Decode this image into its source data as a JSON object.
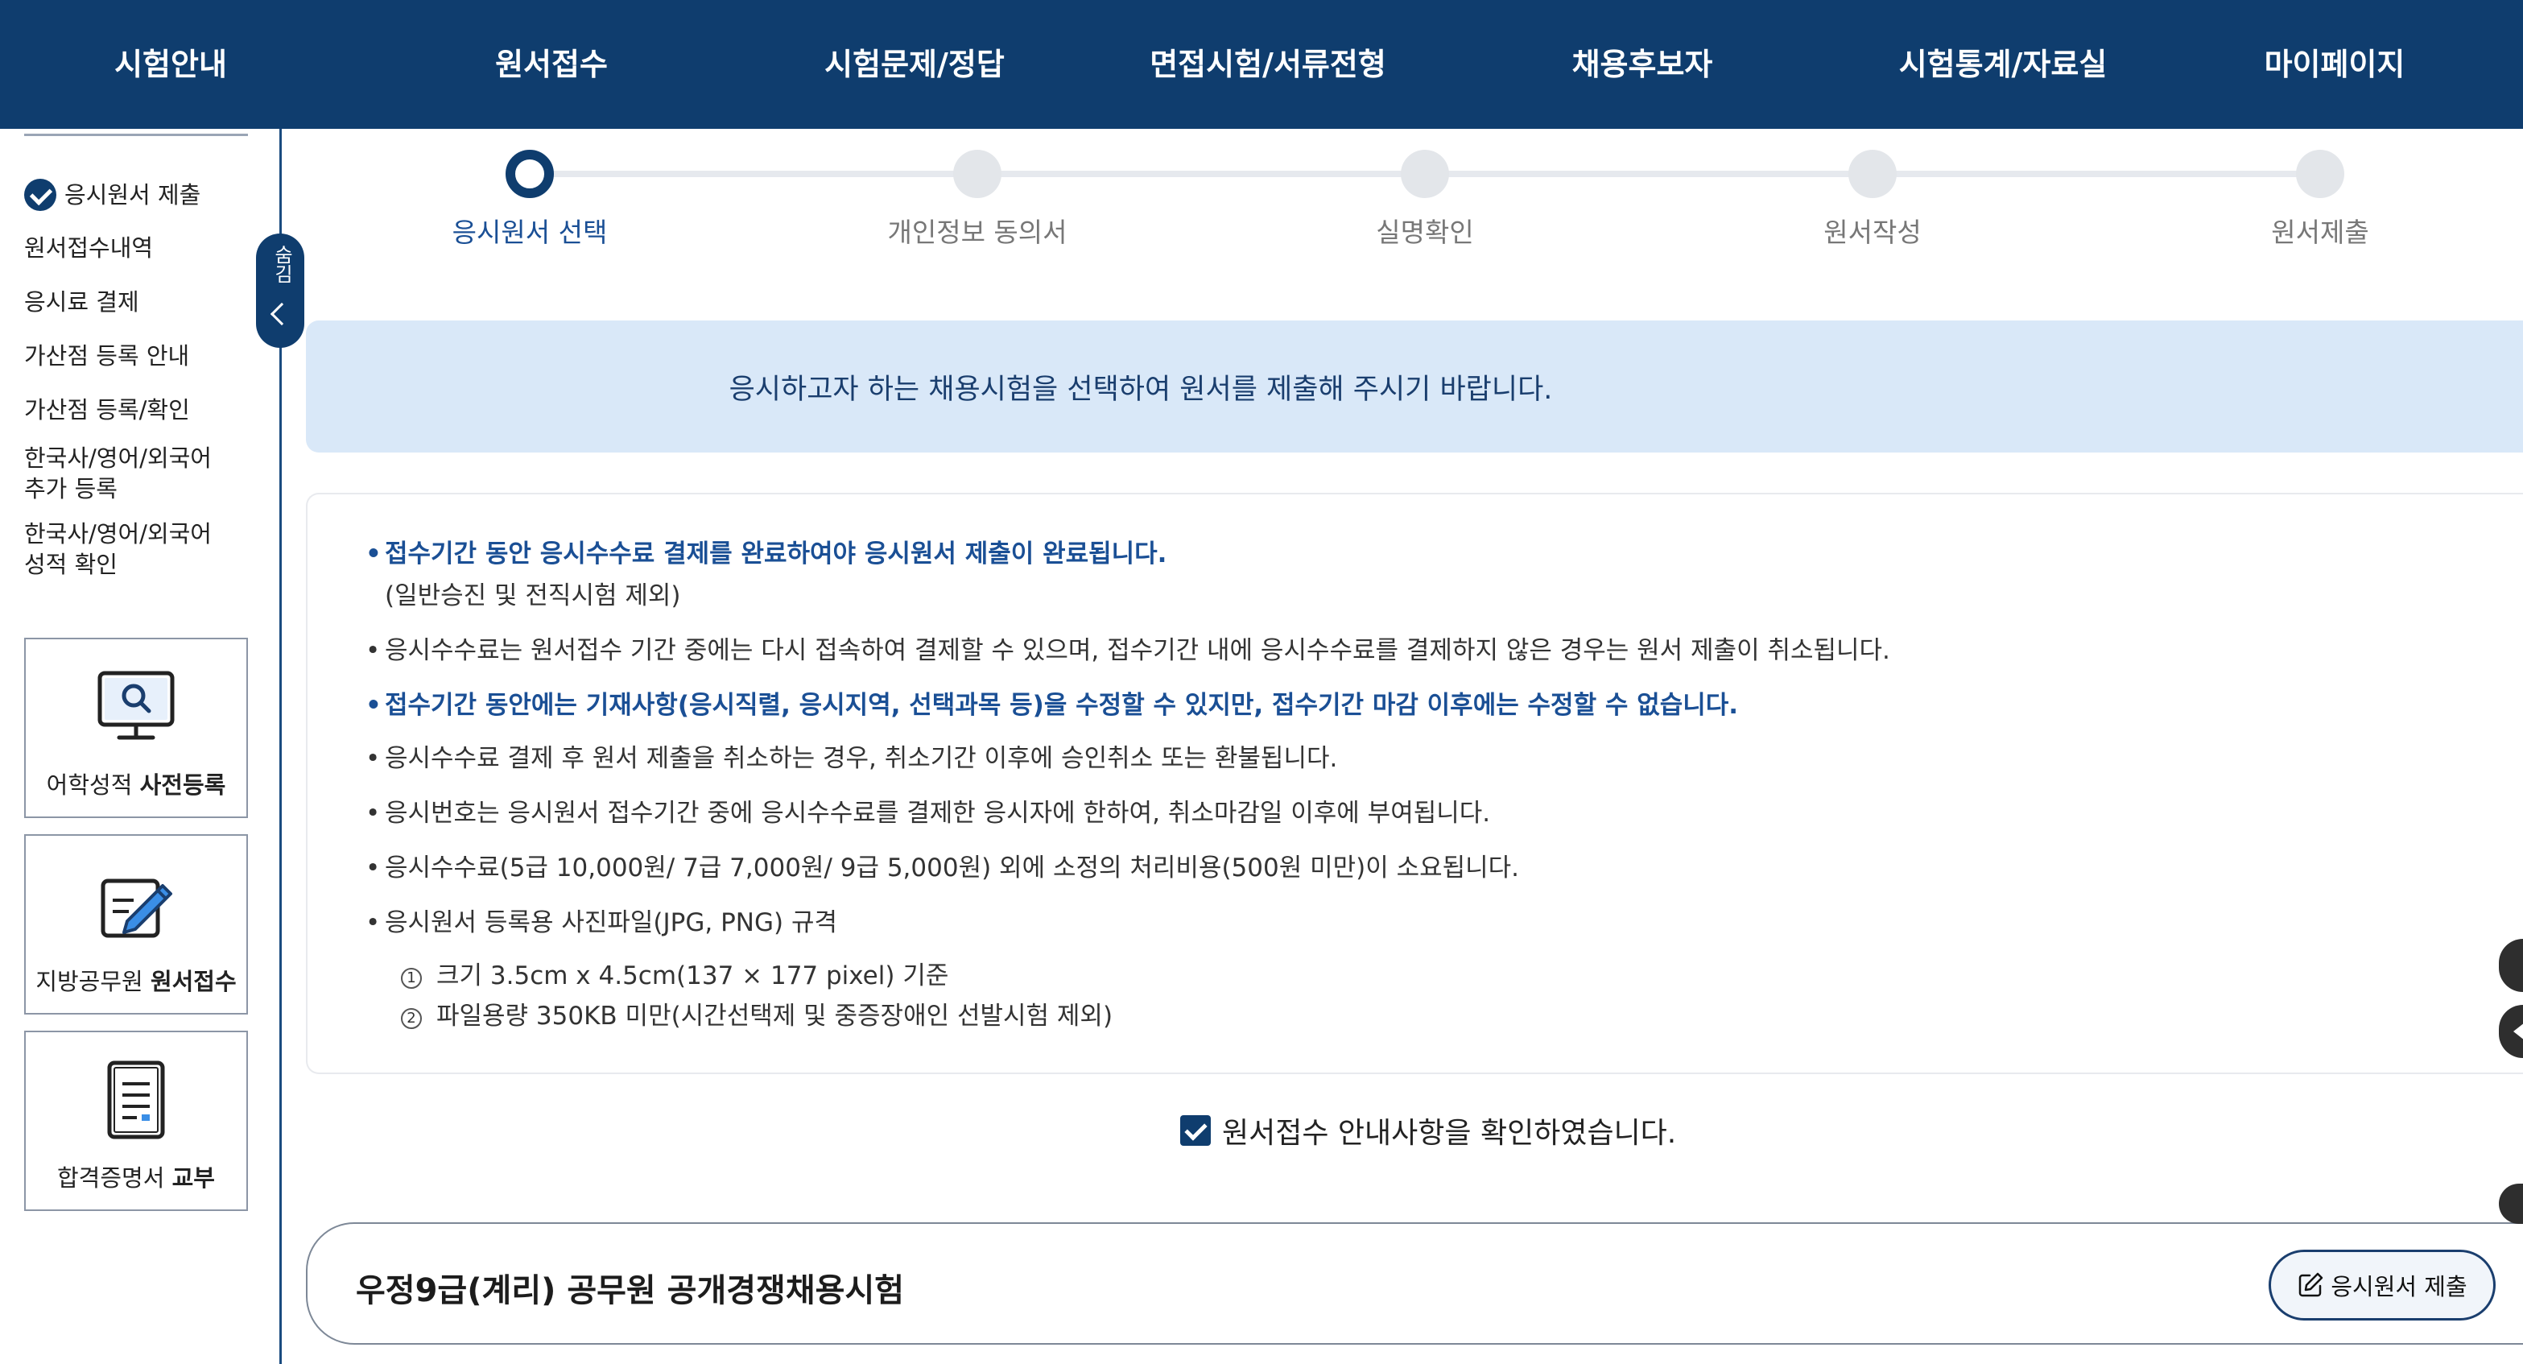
{
  "nav": {
    "items": [
      "시험안내",
      "원서접수",
      "시험문제/정답",
      "면접시험/서류전형",
      "채용후보자",
      "시험통계/자료실",
      "마이페이지"
    ]
  },
  "sidebar": {
    "menu": [
      "응시원서 제출",
      "원서접수내역",
      "응시료 결제",
      "가산점 등록 안내",
      "가산점 등록/확인",
      "한국사/영어/외국어",
      "추가 등록",
      "한국사/영어/외국어",
      "성적 확인"
    ],
    "cards": [
      {
        "label_plain": "어학성적 ",
        "label_bold": "사전등록",
        "icon": "monitor-search-icon"
      },
      {
        "label_plain": "지방공무원 ",
        "label_bold": "원서접수",
        "icon": "edit-form-icon"
      },
      {
        "label_plain": "합격증명서 ",
        "label_bold": "교부",
        "icon": "certificate-document-icon"
      }
    ],
    "collapse_label": "숨김"
  },
  "stepper": {
    "steps": [
      "응시원서 선택",
      "개인정보 동의서",
      "실명확인",
      "원서작성",
      "원서제출"
    ],
    "active_index": 0
  },
  "banner": {
    "text": "응시하고자 하는 채용시험을 선택하여 원서를 제출해 주시기 바랍니다."
  },
  "notice": {
    "bullet": "•",
    "items": [
      "접수기간 동안 응시수수료 결제를 완료하여야 응시원서 제출이 완료됩니다.",
      "(일반승진 및 전직시험 제외)",
      "응시수수료는 원서접수 기간 중에는 다시 접속하여 결제할 수 있으며, 접수기간 내에 응시수수료를 결제하지 않은 경우는 원서 제출이 취소됩니다.",
      "접수기간 동안에는 기재사항(응시직렬, 응시지역, 선택과목 등)을 수정할 수 있지만, 접수기간 마감 이후에는 수정할 수 없습니다.",
      "응시수수료 결제 후 원서 제출을 취소하는 경우, 취소기간 이후에 승인취소 또는 환불됩니다.",
      "응시번호는 응시원서 접수기간 중에 응시수수료를 결제한 응시자에 한하여, 취소마감일 이후에 부여됩니다.",
      "응시수수료(5급 10,000원/ 7급 7,000원/ 9급 5,000원) 외에 소정의 처리비용(500원 미만)이 소요됩니다.",
      "응시원서 등록용 사진파일(JPG, PNG) 규격"
    ],
    "sub_items": [
      {
        "num": "1",
        "text": "크기 3.5cm x 4.5cm(137 × 177 pixel) 기준"
      },
      {
        "num": "2",
        "text": "파일용량 350KB 미만(시간선택제 및 중증장애인 선발시험 제외)"
      }
    ]
  },
  "agreement": {
    "label": "원서접수 안내사항을 확인하였습니다.",
    "checked": true
  },
  "exam": {
    "title": "우정9급(계리) 공무원 공개경쟁채용시험",
    "submit_label": "응시원서 제출"
  },
  "colors": {
    "nav_bg": "#0f3d6e",
    "accent": "#1a4f95",
    "banner_bg": "#d9e8f8"
  }
}
